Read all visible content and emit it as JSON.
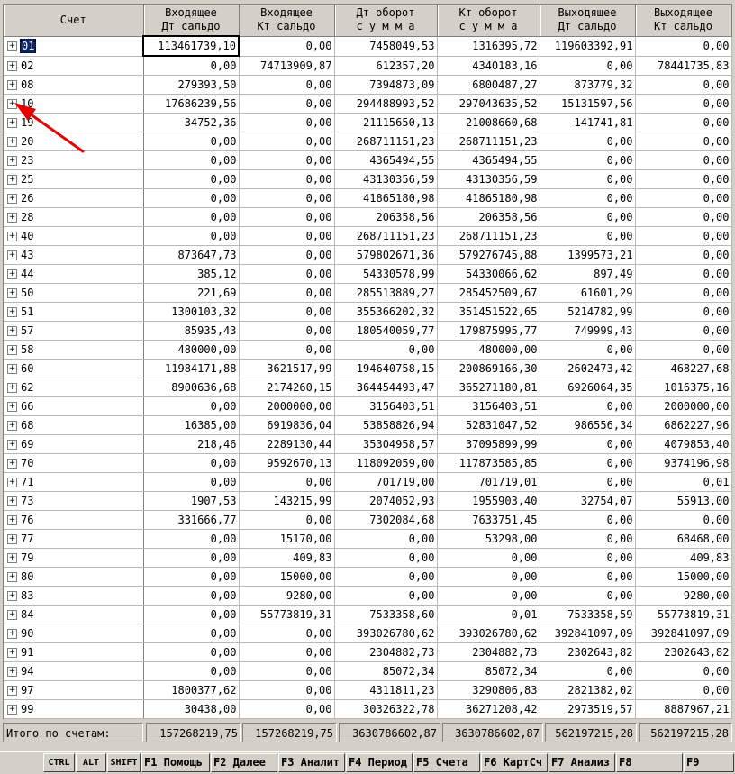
{
  "headers": [
    {
      "l1": "Счет",
      "l2": ""
    },
    {
      "l1": "Входящее",
      "l2": "Дт сальдо"
    },
    {
      "l1": "Входящее",
      "l2": "Кт сальдо"
    },
    {
      "l1": "Дт оборот",
      "l2": "с у м м а"
    },
    {
      "l1": "Кт оборот",
      "l2": "с у м м а"
    },
    {
      "l1": "Выходящее",
      "l2": "Дт сальдо"
    },
    {
      "l1": "Выходящее",
      "l2": "Кт сальдо"
    }
  ],
  "expander_glyph": "+",
  "rows": [
    {
      "acct": "01",
      "in_dt": "113461739,10",
      "in_kt": "0,00",
      "turn_dt": "7458049,53",
      "turn_kt": "1316395,72",
      "out_dt": "119603392,91",
      "out_kt": "0,00"
    },
    {
      "acct": "02",
      "in_dt": "0,00",
      "in_kt": "74713909,87",
      "turn_dt": "612357,20",
      "turn_kt": "4340183,16",
      "out_dt": "0,00",
      "out_kt": "78441735,83"
    },
    {
      "acct": "08",
      "in_dt": "279393,50",
      "in_kt": "0,00",
      "turn_dt": "7394873,09",
      "turn_kt": "6800487,27",
      "out_dt": "873779,32",
      "out_kt": "0,00"
    },
    {
      "acct": "10",
      "in_dt": "17686239,56",
      "in_kt": "0,00",
      "turn_dt": "294488993,52",
      "turn_kt": "297043635,52",
      "out_dt": "15131597,56",
      "out_kt": "0,00"
    },
    {
      "acct": "19",
      "in_dt": "34752,36",
      "in_kt": "0,00",
      "turn_dt": "21115650,13",
      "turn_kt": "21008660,68",
      "out_dt": "141741,81",
      "out_kt": "0,00"
    },
    {
      "acct": "20",
      "in_dt": "0,00",
      "in_kt": "0,00",
      "turn_dt": "268711151,23",
      "turn_kt": "268711151,23",
      "out_dt": "0,00",
      "out_kt": "0,00"
    },
    {
      "acct": "23",
      "in_dt": "0,00",
      "in_kt": "0,00",
      "turn_dt": "4365494,55",
      "turn_kt": "4365494,55",
      "out_dt": "0,00",
      "out_kt": "0,00"
    },
    {
      "acct": "25",
      "in_dt": "0,00",
      "in_kt": "0,00",
      "turn_dt": "43130356,59",
      "turn_kt": "43130356,59",
      "out_dt": "0,00",
      "out_kt": "0,00"
    },
    {
      "acct": "26",
      "in_dt": "0,00",
      "in_kt": "0,00",
      "turn_dt": "41865180,98",
      "turn_kt": "41865180,98",
      "out_dt": "0,00",
      "out_kt": "0,00"
    },
    {
      "acct": "28",
      "in_dt": "0,00",
      "in_kt": "0,00",
      "turn_dt": "206358,56",
      "turn_kt": "206358,56",
      "out_dt": "0,00",
      "out_kt": "0,00"
    },
    {
      "acct": "40",
      "in_dt": "0,00",
      "in_kt": "0,00",
      "turn_dt": "268711151,23",
      "turn_kt": "268711151,23",
      "out_dt": "0,00",
      "out_kt": "0,00"
    },
    {
      "acct": "43",
      "in_dt": "873647,73",
      "in_kt": "0,00",
      "turn_dt": "579802671,36",
      "turn_kt": "579276745,88",
      "out_dt": "1399573,21",
      "out_kt": "0,00"
    },
    {
      "acct": "44",
      "in_dt": "385,12",
      "in_kt": "0,00",
      "turn_dt": "54330578,99",
      "turn_kt": "54330066,62",
      "out_dt": "897,49",
      "out_kt": "0,00"
    },
    {
      "acct": "50",
      "in_dt": "221,69",
      "in_kt": "0,00",
      "turn_dt": "285513889,27",
      "turn_kt": "285452509,67",
      "out_dt": "61601,29",
      "out_kt": "0,00"
    },
    {
      "acct": "51",
      "in_dt": "1300103,32",
      "in_kt": "0,00",
      "turn_dt": "355366202,32",
      "turn_kt": "351451522,65",
      "out_dt": "5214782,99",
      "out_kt": "0,00"
    },
    {
      "acct": "57",
      "in_dt": "85935,43",
      "in_kt": "0,00",
      "turn_dt": "180540059,77",
      "turn_kt": "179875995,77",
      "out_dt": "749999,43",
      "out_kt": "0,00"
    },
    {
      "acct": "58",
      "in_dt": "480000,00",
      "in_kt": "0,00",
      "turn_dt": "0,00",
      "turn_kt": "480000,00",
      "out_dt": "0,00",
      "out_kt": "0,00"
    },
    {
      "acct": "60",
      "in_dt": "11984171,88",
      "in_kt": "3621517,99",
      "turn_dt": "194640758,15",
      "turn_kt": "200869166,30",
      "out_dt": "2602473,42",
      "out_kt": "468227,68"
    },
    {
      "acct": "62",
      "in_dt": "8900636,68",
      "in_kt": "2174260,15",
      "turn_dt": "364454493,47",
      "turn_kt": "365271180,81",
      "out_dt": "6926064,35",
      "out_kt": "1016375,16"
    },
    {
      "acct": "66",
      "in_dt": "0,00",
      "in_kt": "2000000,00",
      "turn_dt": "3156403,51",
      "turn_kt": "3156403,51",
      "out_dt": "0,00",
      "out_kt": "2000000,00"
    },
    {
      "acct": "68",
      "in_dt": "16385,00",
      "in_kt": "6919836,04",
      "turn_dt": "53858826,94",
      "turn_kt": "52831047,52",
      "out_dt": "986556,34",
      "out_kt": "6862227,96"
    },
    {
      "acct": "69",
      "in_dt": "218,46",
      "in_kt": "2289130,44",
      "turn_dt": "35304958,57",
      "turn_kt": "37095899,99",
      "out_dt": "0,00",
      "out_kt": "4079853,40"
    },
    {
      "acct": "70",
      "in_dt": "0,00",
      "in_kt": "9592670,13",
      "turn_dt": "118092059,00",
      "turn_kt": "117873585,85",
      "out_dt": "0,00",
      "out_kt": "9374196,98"
    },
    {
      "acct": "71",
      "in_dt": "0,00",
      "in_kt": "0,00",
      "turn_dt": "701719,00",
      "turn_kt": "701719,01",
      "out_dt": "0,00",
      "out_kt": "0,01"
    },
    {
      "acct": "73",
      "in_dt": "1907,53",
      "in_kt": "143215,99",
      "turn_dt": "2074052,93",
      "turn_kt": "1955903,40",
      "out_dt": "32754,07",
      "out_kt": "55913,00"
    },
    {
      "acct": "76",
      "in_dt": "331666,77",
      "in_kt": "0,00",
      "turn_dt": "7302084,68",
      "turn_kt": "7633751,45",
      "out_dt": "0,00",
      "out_kt": "0,00"
    },
    {
      "acct": "77",
      "in_dt": "0,00",
      "in_kt": "15170,00",
      "turn_dt": "0,00",
      "turn_kt": "53298,00",
      "out_dt": "0,00",
      "out_kt": "68468,00"
    },
    {
      "acct": "79",
      "in_dt": "0,00",
      "in_kt": "409,83",
      "turn_dt": "0,00",
      "turn_kt": "0,00",
      "out_dt": "0,00",
      "out_kt": "409,83"
    },
    {
      "acct": "80",
      "in_dt": "0,00",
      "in_kt": "15000,00",
      "turn_dt": "0,00",
      "turn_kt": "0,00",
      "out_dt": "0,00",
      "out_kt": "15000,00"
    },
    {
      "acct": "83",
      "in_dt": "0,00",
      "in_kt": "9280,00",
      "turn_dt": "0,00",
      "turn_kt": "0,00",
      "out_dt": "0,00",
      "out_kt": "9280,00"
    },
    {
      "acct": "84",
      "in_dt": "0,00",
      "in_kt": "55773819,31",
      "turn_dt": "7533358,60",
      "turn_kt": "0,01",
      "out_dt": "7533358,59",
      "out_kt": "55773819,31"
    },
    {
      "acct": "90",
      "in_dt": "0,00",
      "in_kt": "0,00",
      "turn_dt": "393026780,62",
      "turn_kt": "393026780,62",
      "out_dt": "392841097,09",
      "out_kt": "392841097,09"
    },
    {
      "acct": "91",
      "in_dt": "0,00",
      "in_kt": "0,00",
      "turn_dt": "2304882,73",
      "turn_kt": "2304882,73",
      "out_dt": "2302643,82",
      "out_kt": "2302643,82"
    },
    {
      "acct": "94",
      "in_dt": "0,00",
      "in_kt": "0,00",
      "turn_dt": "85072,34",
      "turn_kt": "85072,34",
      "out_dt": "0,00",
      "out_kt": "0,00"
    },
    {
      "acct": "97",
      "in_dt": "1800377,62",
      "in_kt": "0,00",
      "turn_dt": "4311811,23",
      "turn_kt": "3290806,83",
      "out_dt": "2821382,02",
      "out_kt": "0,00"
    },
    {
      "acct": "99",
      "in_dt": "30438,00",
      "in_kt": "0,00",
      "turn_dt": "30326322,78",
      "turn_kt": "36271208,42",
      "out_dt": "2973519,57",
      "out_kt": "8887967,21"
    }
  ],
  "totals": {
    "label": "Итого по счетам:",
    "in_dt": "157268219,75",
    "in_kt": "157268219,75",
    "turn_dt": "3630786602,87",
    "turn_kt": "3630786602,87",
    "out_dt": "562197215,28",
    "out_kt": "562197215,28"
  },
  "function_bar": {
    "ctrl": "CTRL",
    "alt": "ALT",
    "shift": "SHIFT",
    "f1": "F1 Помощь",
    "f2": "F2 Далее",
    "f3": "F3 Аналит",
    "f4": "F4 Период",
    "f5": "F5 Счета",
    "f6": "F6 КартСч",
    "f7": "F7 Анализ",
    "f8": "F8",
    "f9": "F9"
  },
  "colors": {
    "selection_bg": "#0a246a",
    "selection_fg": "#ffffff",
    "annotation_arrow": "#e60000",
    "window_bg": "#d4d0c8"
  }
}
